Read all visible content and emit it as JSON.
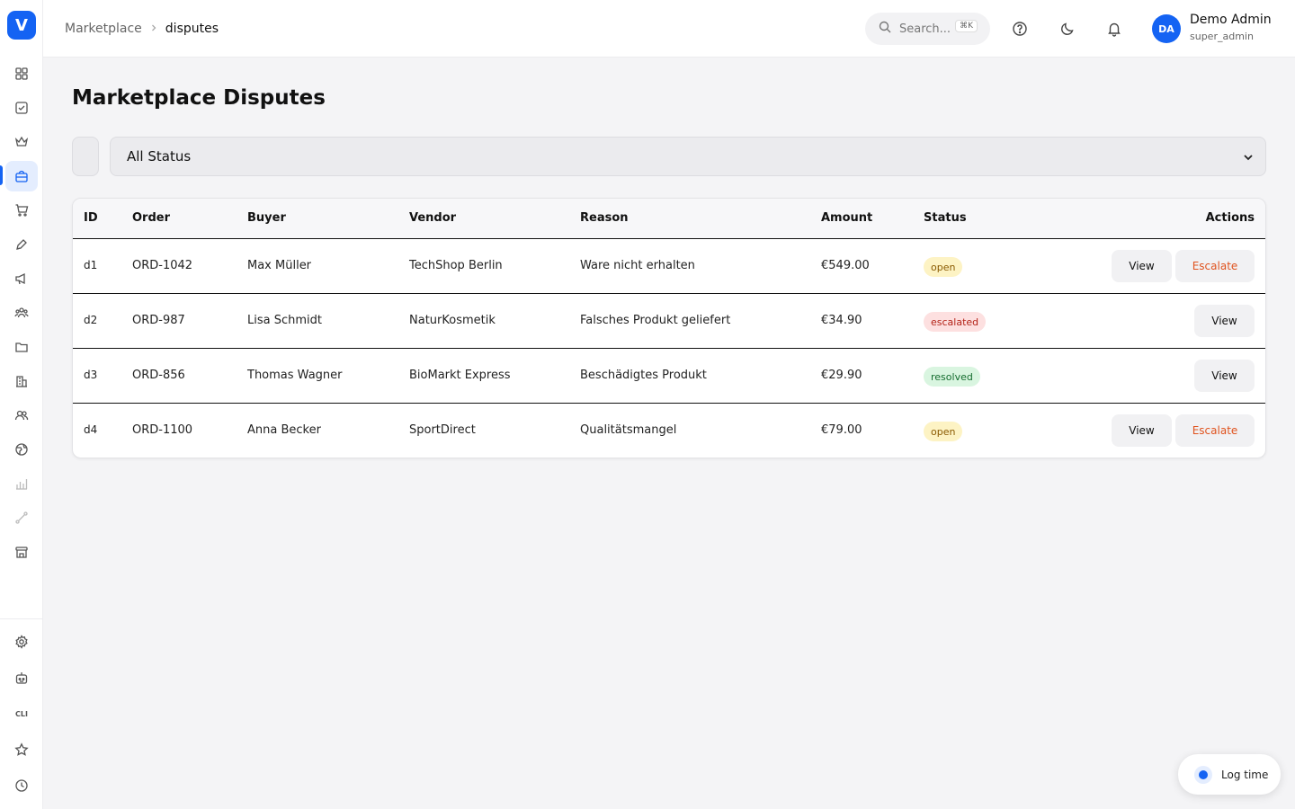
{
  "brand": {
    "logo_letter": "V",
    "accent": "#1463f3"
  },
  "sidebar": {
    "items": [
      {
        "name": "dashboard-icon"
      },
      {
        "name": "tasks-icon"
      },
      {
        "name": "crown-icon"
      },
      {
        "name": "marketplace-icon",
        "active": true
      },
      {
        "name": "cart-icon"
      },
      {
        "name": "pen-icon"
      },
      {
        "name": "megaphone-icon"
      },
      {
        "name": "team-icon"
      },
      {
        "name": "folder-icon"
      },
      {
        "name": "building-icon"
      },
      {
        "name": "users-icon"
      },
      {
        "name": "globe-icon"
      },
      {
        "name": "analytics-icon"
      },
      {
        "name": "route-icon"
      },
      {
        "name": "store-icon"
      }
    ],
    "bottom": [
      {
        "name": "settings-icon"
      },
      {
        "name": "bot-icon"
      },
      {
        "name": "cli-label",
        "label": "CLI"
      },
      {
        "name": "star-icon"
      },
      {
        "name": "clock-icon"
      }
    ]
  },
  "header": {
    "breadcrumb": {
      "parent": "Marketplace",
      "separator": ">",
      "current": "disputes"
    },
    "search": {
      "placeholder": "Search...",
      "shortcut": "⌘K"
    },
    "user": {
      "initials": "DA",
      "name": "Demo Admin",
      "role": "super_admin"
    }
  },
  "main": {
    "title": "Marketplace Disputes",
    "filter": {
      "selected": "All Status"
    },
    "table": {
      "columns": [
        "ID",
        "Order",
        "Buyer",
        "Vendor",
        "Reason",
        "Amount",
        "Status",
        "Actions"
      ],
      "rows": [
        {
          "id": "d1",
          "order": "ORD-1042",
          "buyer": "Max Müller",
          "vendor": "TechShop Berlin",
          "reason": "Ware nicht erhalten",
          "amount": "€549.00",
          "status": "open",
          "actions": [
            "View",
            "Escalate"
          ]
        },
        {
          "id": "d2",
          "order": "ORD-987",
          "buyer": "Lisa Schmidt",
          "vendor": "NaturKosmetik",
          "reason": "Falsches Produkt geliefert",
          "amount": "€34.90",
          "status": "escalated",
          "actions": [
            "View"
          ]
        },
        {
          "id": "d3",
          "order": "ORD-856",
          "buyer": "Thomas Wagner",
          "vendor": "BioMarkt Express",
          "reason": "Beschädigtes Produkt",
          "amount": "€29.90",
          "status": "resolved",
          "actions": [
            "View"
          ]
        },
        {
          "id": "d4",
          "order": "ORD-1100",
          "buyer": "Anna Becker",
          "vendor": "SportDirect",
          "reason": "Qualitätsmangel",
          "amount": "€79.00",
          "status": "open",
          "actions": [
            "View",
            "Escalate"
          ]
        }
      ]
    }
  },
  "log_time": {
    "label": "Log time"
  }
}
